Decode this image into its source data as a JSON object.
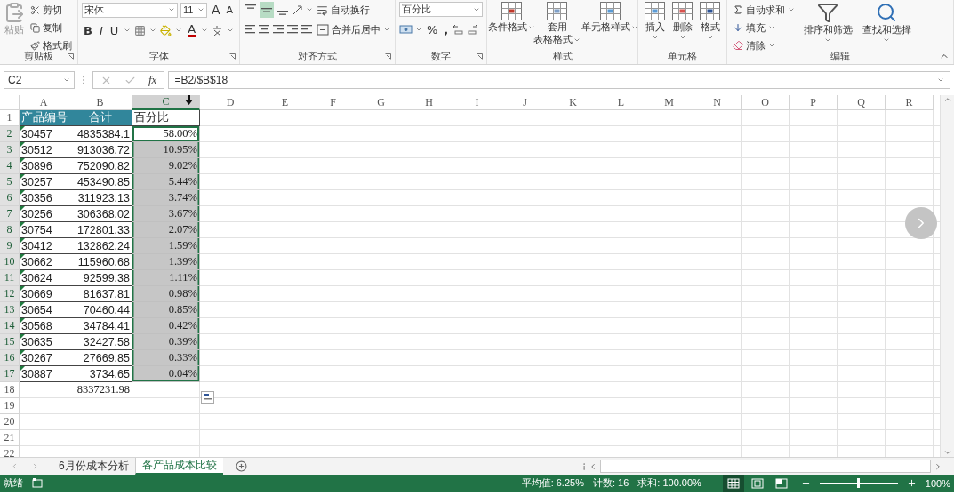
{
  "ribbon": {
    "clipboard": {
      "label": "剪贴板",
      "paste": {
        "label": "粘贴",
        "disabled": true
      },
      "items": [
        "剪切",
        "复制",
        "格式刷"
      ]
    },
    "font": {
      "label": "字体",
      "family": "宋体",
      "size": "11",
      "grow": "A",
      "shrink": "A",
      "bold": "B",
      "italic": "I",
      "underline": "U",
      "font_color": "A"
    },
    "alignment": {
      "label": "对齐方式",
      "vertical": [
        {
          "selected": false
        },
        {
          "selected": true
        },
        {
          "selected": false
        }
      ],
      "wrap": "自动换行",
      "merge": "合并后居中"
    },
    "number": {
      "label": "数字",
      "format": "百分比",
      "percent": "%",
      "comma": ","
    },
    "styles": {
      "label": "样式",
      "buttons": [
        [
          "条件格式"
        ],
        [
          "套用",
          "表格格式"
        ],
        [
          "单元格样式"
        ]
      ]
    },
    "cells": {
      "label": "单元格",
      "buttons": [
        "插入",
        "删除",
        "格式"
      ]
    },
    "editing": {
      "label": "编辑",
      "autosum": "自动求和",
      "fill": "填充",
      "clear": "清除",
      "sort": "排序和筛选",
      "find": "查找和选择"
    }
  },
  "formula_bar": {
    "name_box": "C2",
    "fx": "fx",
    "formula": "=B2/$B$18"
  },
  "table": {
    "columns": [
      {
        "label": "A",
        "selected": false
      },
      {
        "label": "B",
        "selected": false
      },
      {
        "label": "C",
        "selected": true
      },
      {
        "label": "D",
        "selected": false
      },
      {
        "label": "E",
        "selected": false
      },
      {
        "label": "F",
        "selected": false
      },
      {
        "label": "G",
        "selected": false
      },
      {
        "label": "H",
        "selected": false
      },
      {
        "label": "I",
        "selected": false
      },
      {
        "label": "J",
        "selected": false
      },
      {
        "label": "K",
        "selected": false
      },
      {
        "label": "L",
        "selected": false
      },
      {
        "label": "M",
        "selected": false
      },
      {
        "label": "N",
        "selected": false
      },
      {
        "label": "O",
        "selected": false
      },
      {
        "label": "P",
        "selected": false
      },
      {
        "label": "Q",
        "selected": false
      },
      {
        "label": "R",
        "selected": false
      }
    ],
    "rows": [
      {
        "number": "1",
        "kind": "header",
        "selected": false,
        "a": "产品编号",
        "b": "合计",
        "c": "百分比"
      },
      {
        "number": "2",
        "kind": "data",
        "selected": true,
        "a": {
          "text": "30457",
          "flagged": true
        },
        "b": "4835384.1",
        "c": {
          "text": "58.00%",
          "active": true
        }
      },
      {
        "number": "3",
        "kind": "data",
        "selected": true,
        "a": {
          "text": "30512",
          "flagged": true
        },
        "b": "913036.72",
        "c": {
          "text": "10.95%",
          "active": false
        }
      },
      {
        "number": "4",
        "kind": "data",
        "selected": true,
        "a": {
          "text": "30896",
          "flagged": true
        },
        "b": "752090.82",
        "c": {
          "text": "9.02%",
          "active": false
        }
      },
      {
        "number": "5",
        "kind": "data",
        "selected": true,
        "a": {
          "text": "30257",
          "flagged": true
        },
        "b": "453490.85",
        "c": {
          "text": "5.44%",
          "active": false
        }
      },
      {
        "number": "6",
        "kind": "data",
        "selected": true,
        "a": {
          "text": "30356",
          "flagged": true
        },
        "b": "311923.13",
        "c": {
          "text": "3.74%",
          "active": false
        }
      },
      {
        "number": "7",
        "kind": "data",
        "selected": true,
        "a": {
          "text": "30256",
          "flagged": true
        },
        "b": "306368.02",
        "c": {
          "text": "3.67%",
          "active": false
        }
      },
      {
        "number": "8",
        "kind": "data",
        "selected": true,
        "a": {
          "text": "30754",
          "flagged": true
        },
        "b": "172801.33",
        "c": {
          "text": "2.07%",
          "active": false
        }
      },
      {
        "number": "9",
        "kind": "data",
        "selected": true,
        "a": {
          "text": "30412",
          "flagged": true
        },
        "b": "132862.24",
        "c": {
          "text": "1.59%",
          "active": false
        }
      },
      {
        "number": "10",
        "kind": "data",
        "selected": true,
        "a": {
          "text": "30662",
          "flagged": true
        },
        "b": "115960.68",
        "c": {
          "text": "1.39%",
          "active": false
        }
      },
      {
        "number": "11",
        "kind": "data",
        "selected": true,
        "a": {
          "text": "30624",
          "flagged": true
        },
        "b": "92599.38",
        "c": {
          "text": "1.11%",
          "active": false
        }
      },
      {
        "number": "12",
        "kind": "data",
        "selected": true,
        "a": {
          "text": "30669",
          "flagged": true
        },
        "b": "81637.81",
        "c": {
          "text": "0.98%",
          "active": false
        }
      },
      {
        "number": "13",
        "kind": "data",
        "selected": true,
        "a": {
          "text": "30654",
          "flagged": true
        },
        "b": "70460.44",
        "c": {
          "text": "0.85%",
          "active": false
        }
      },
      {
        "number": "14",
        "kind": "data",
        "selected": true,
        "a": {
          "text": "30568",
          "flagged": true
        },
        "b": "34784.41",
        "c": {
          "text": "0.42%",
          "active": false
        }
      },
      {
        "number": "15",
        "kind": "data",
        "selected": true,
        "a": {
          "text": "30635",
          "flagged": true
        },
        "b": "32427.58",
        "c": {
          "text": "0.39%",
          "active": false
        }
      },
      {
        "number": "16",
        "kind": "data",
        "selected": true,
        "a": {
          "text": "30267",
          "flagged": true
        },
        "b": "27669.85",
        "c": {
          "text": "0.33%",
          "active": false
        }
      },
      {
        "number": "17",
        "kind": "data",
        "selected": true,
        "a": {
          "text": "30887",
          "flagged": true
        },
        "b": "3734.65",
        "c": {
          "text": "0.04%",
          "active": false
        }
      },
      {
        "number": "18",
        "kind": "total",
        "selected": false,
        "b": "8337231.98"
      },
      {
        "number": "19",
        "kind": "empty",
        "selected": false
      },
      {
        "number": "20",
        "kind": "empty",
        "selected": false
      },
      {
        "number": "21",
        "kind": "empty",
        "selected": false
      },
      {
        "number": "22",
        "kind": "empty",
        "selected": false
      }
    ]
  },
  "sheet_tabs": [
    {
      "label": "6月份成本分析",
      "selected": false
    },
    {
      "label": "各产品成本比较",
      "selected": true
    }
  ],
  "status_bar": {
    "ready": "就绪",
    "stats": [
      "平均值: 6.25%",
      "计数: 16",
      "求和: 100.00%"
    ],
    "views": [
      {
        "selected": true
      },
      {
        "selected": false
      },
      {
        "selected": false
      }
    ],
    "zoom": {
      "level": 0.5,
      "reading": "100%"
    }
  }
}
